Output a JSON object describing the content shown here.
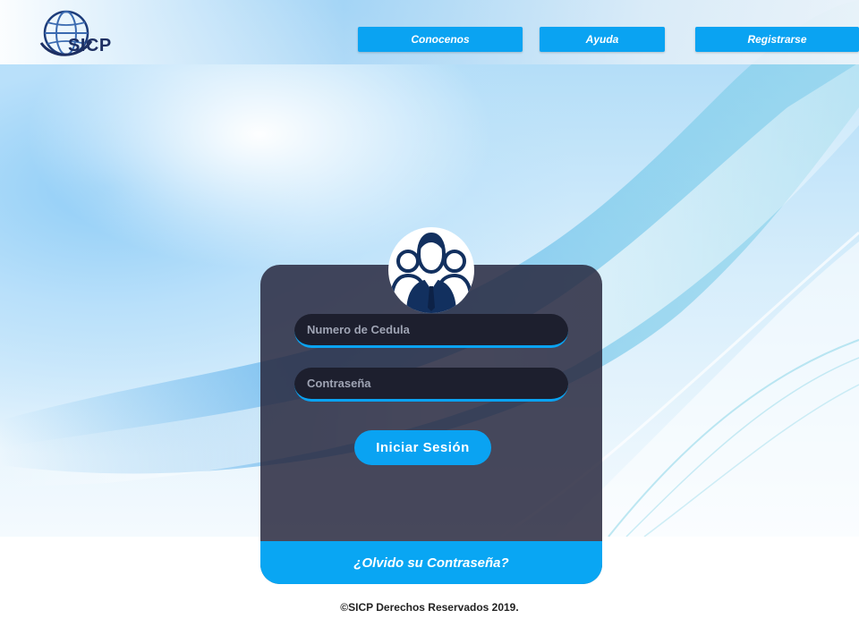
{
  "header": {
    "logo_text": "SICP",
    "nav": [
      {
        "label": "Conocenos"
      },
      {
        "label": "Ayuda"
      },
      {
        "label": "Registrarse"
      }
    ]
  },
  "login": {
    "cedula_placeholder": "Numero de Cedula",
    "password_placeholder": "Contraseña",
    "submit_label": "Iniciar Sesión",
    "forgot_label": "¿Olvido su Contraseña?"
  },
  "footer": {
    "copyright": "©SICP Derechos Reservados  2019."
  },
  "colors": {
    "accent": "#0aa3f2",
    "card": "#2c2d44",
    "field": "#1d1f2e",
    "brand_navy": "#1d2f62"
  },
  "icons": {
    "logo": "globe-icon",
    "avatar": "users-group-icon"
  }
}
